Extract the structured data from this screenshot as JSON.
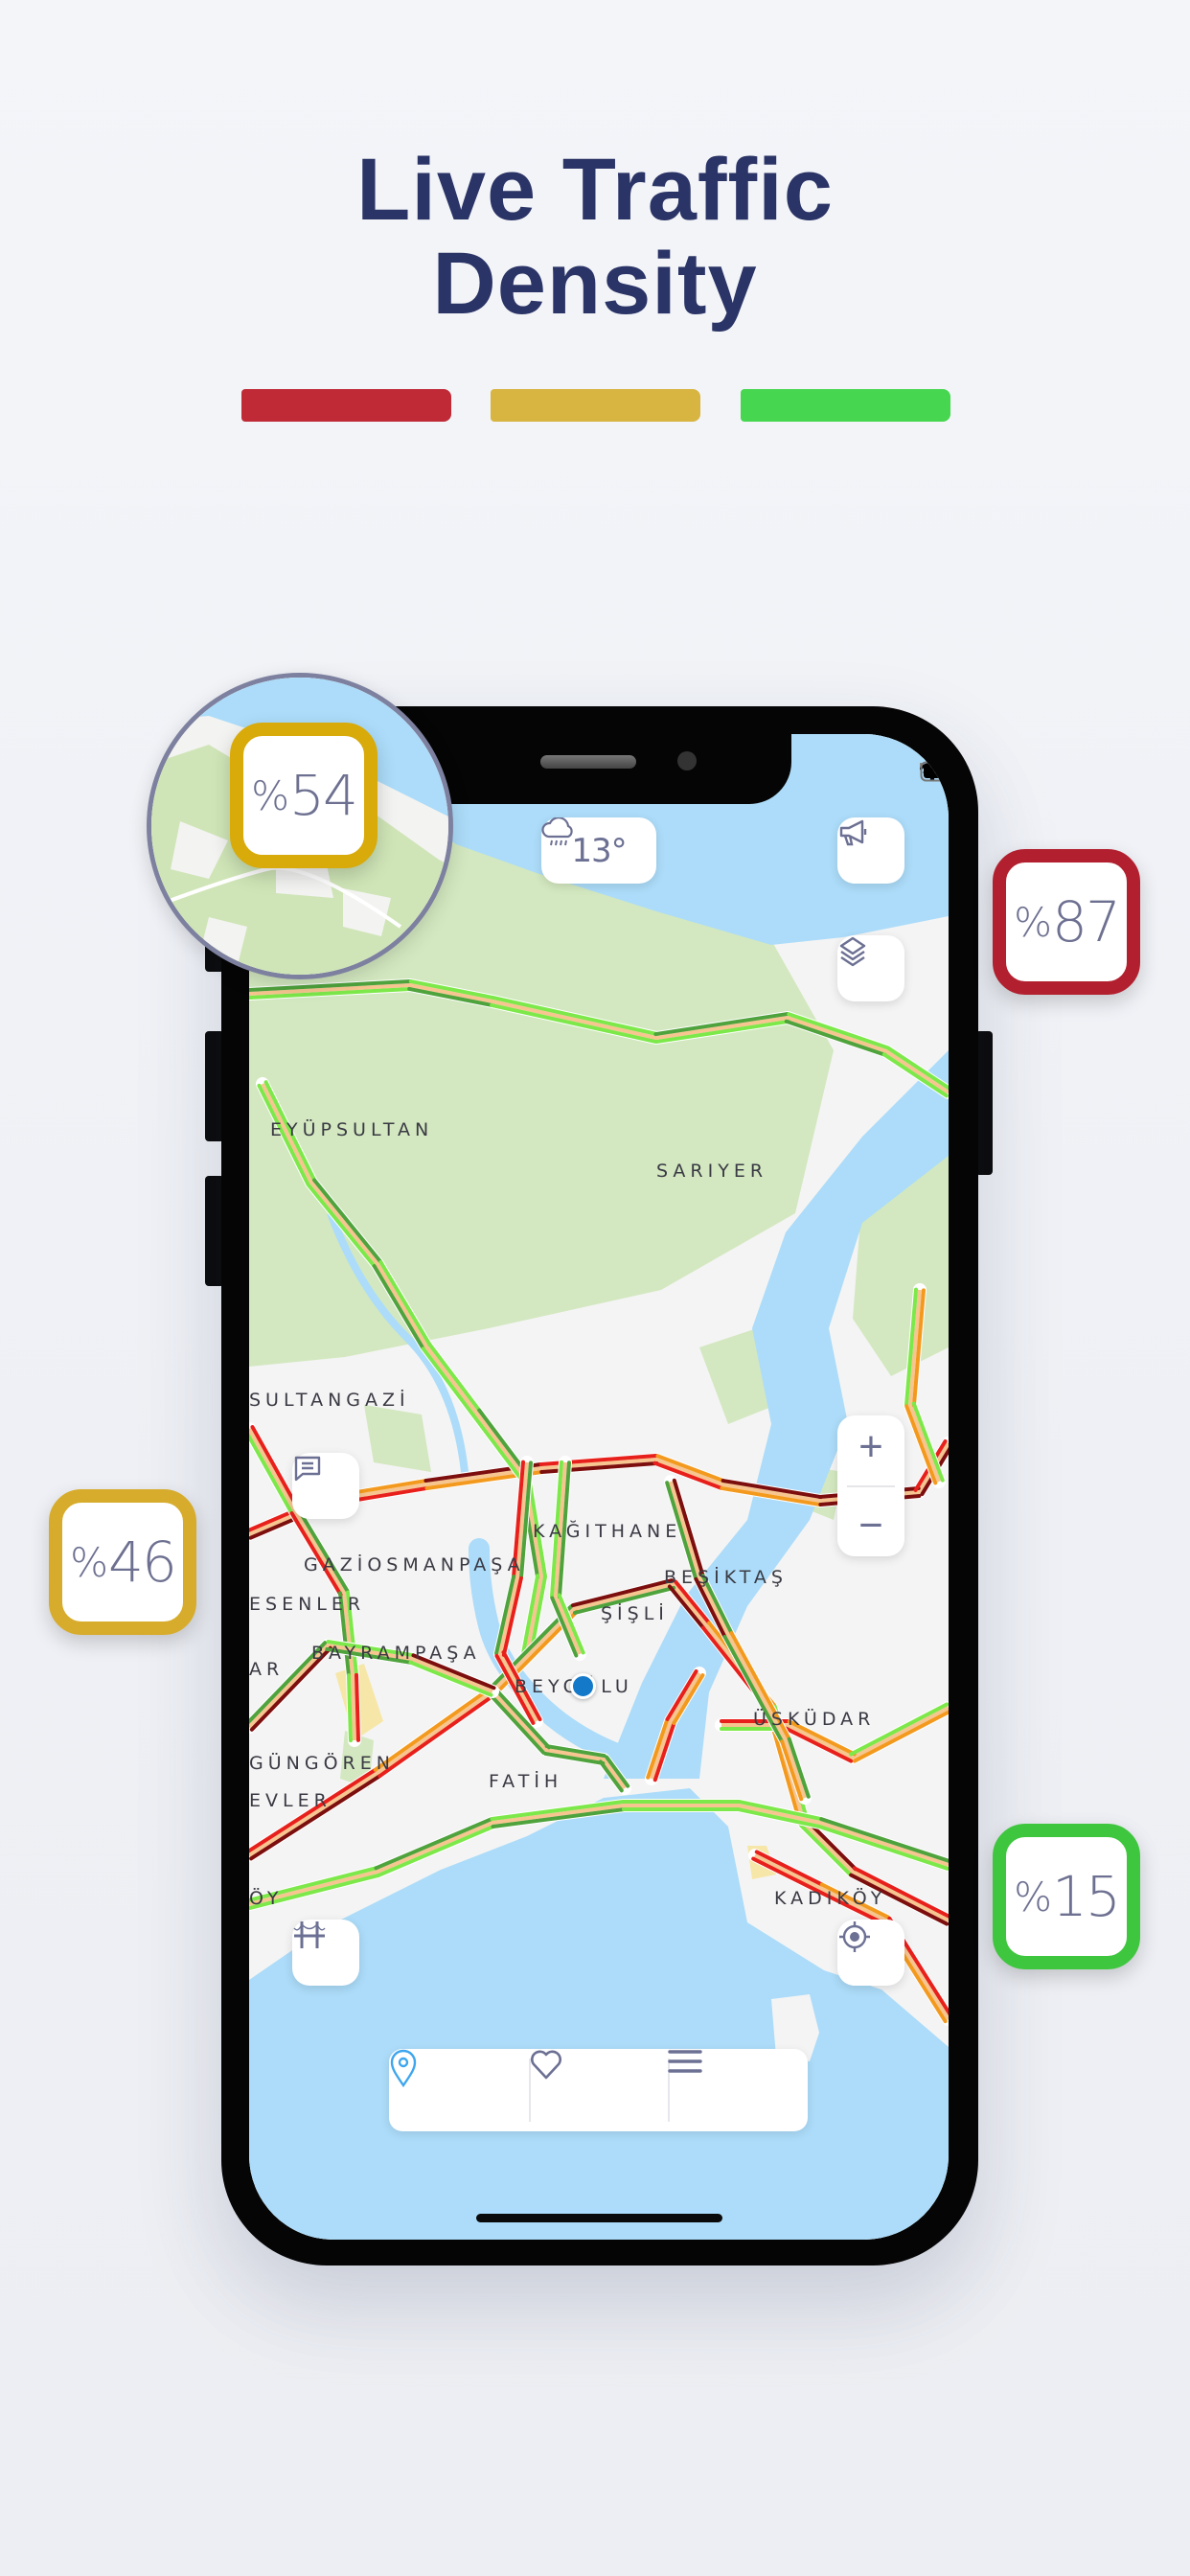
{
  "headline": {
    "line1": "Live Traffic",
    "line2": "Density"
  },
  "legend_colors": {
    "heavy": "#bf2a36",
    "moderate": "#d8b441",
    "light": "#47d650"
  },
  "badges": [
    {
      "value": "54",
      "prefix": "%",
      "color": "#d8aa0a"
    },
    {
      "value": "87",
      "prefix": "%",
      "color": "#b2202f"
    },
    {
      "value": "46",
      "prefix": "%",
      "color": "#d7ac2c"
    },
    {
      "value": "15",
      "prefix": "%",
      "color": "#3fc63f"
    }
  ],
  "status_bar": {
    "icons": [
      "signal-icon",
      "wifi-icon",
      "battery-icon"
    ]
  },
  "weather": {
    "icon": "cloud-rain-icon",
    "temperature": "13°"
  },
  "map_controls": {
    "announcements": "megaphone-icon",
    "layers": "layers-icon",
    "zoom_in": "+",
    "zoom_out": "−",
    "reports": "chat-icon",
    "bridges": "bridge-icon",
    "locate": "crosshair-icon"
  },
  "map_labels": {
    "eyupsultan": "EYÜPSULTAN",
    "sariyer": "SARIYER",
    "sultangazi": "SULTANGAZİ",
    "kagithane": "KAĞITHANE",
    "gaziosmanpasa": "GAZİOSMANPAŞA",
    "besiktas": "BEŞİKTAŞ",
    "esenler": "ESENLER",
    "sisli": "ŞİŞLİ",
    "bayrampasa": "BAYRAMPAŞA",
    "ar": "AR",
    "beyoglu": "BEYOĞLU",
    "uskudar": "ÜSKÜDAR",
    "gungoren": "GÜNGÖREN",
    "fatih": "FATİH",
    "evler": "EVLER",
    "kadikoy": "KADIKÖY",
    "oy": "ÖY"
  },
  "traffic_colors": {
    "free": "#7de84a",
    "light": "#4fa33d",
    "slow": "#f39a1e",
    "heavy": "#e8201c",
    "jam": "#7d0e0e"
  },
  "bottom_nav": [
    {
      "icon": "map-pin-icon",
      "active": true,
      "color": "#3ea6ee"
    },
    {
      "icon": "heart-icon",
      "active": false
    },
    {
      "icon": "menu-icon",
      "active": false
    }
  ]
}
